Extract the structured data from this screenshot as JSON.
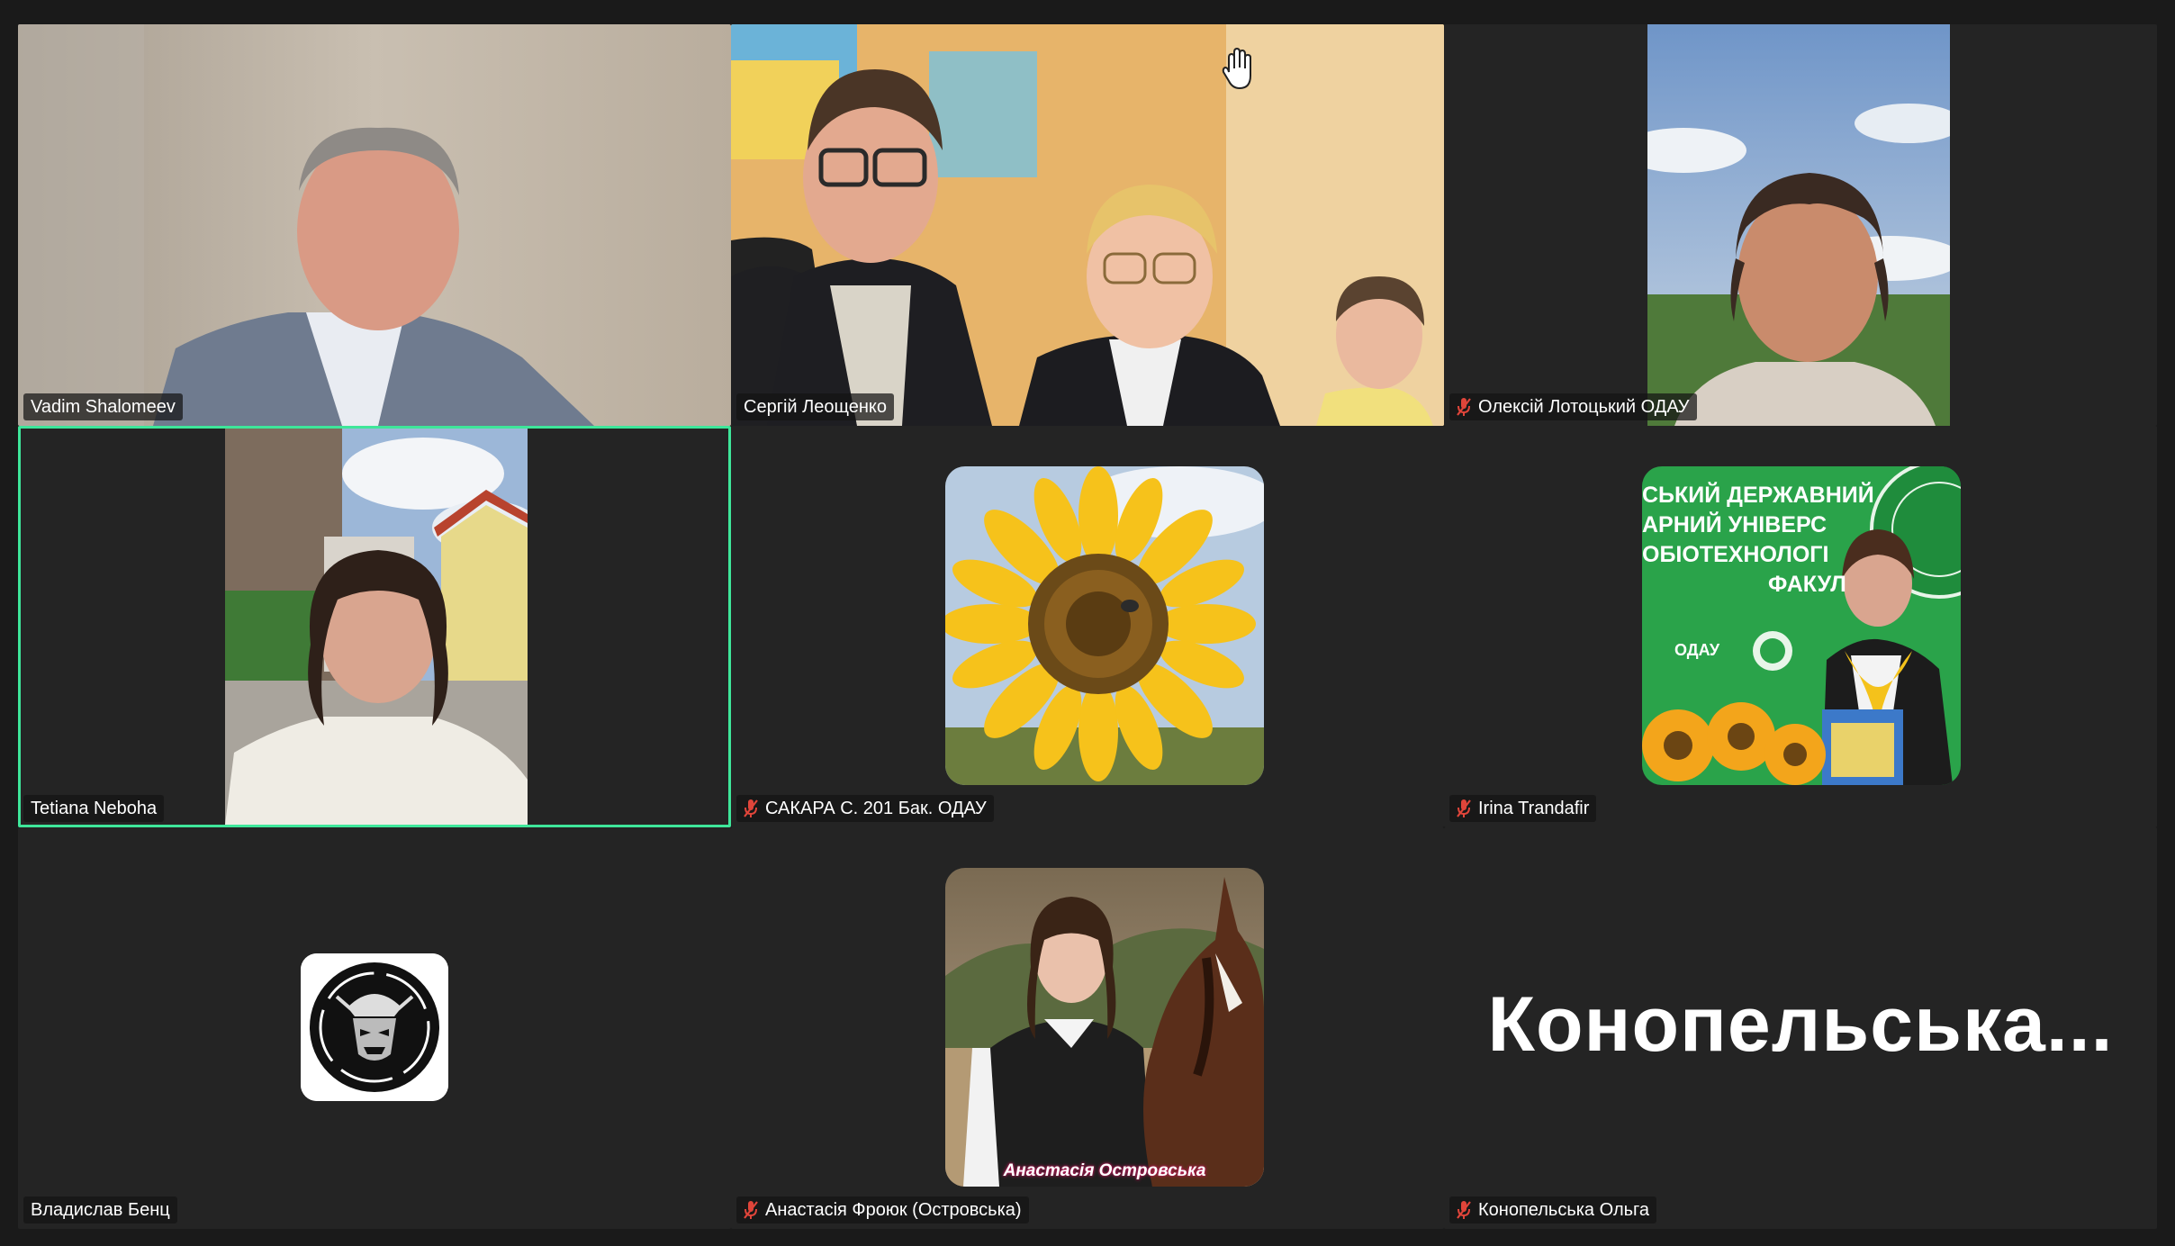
{
  "meeting": {
    "participants": [
      {
        "name": "Vadim Shalomeev",
        "muted": false,
        "active_speaker": false
      },
      {
        "name": "Сергій Леощенко",
        "muted": false,
        "active_speaker": false,
        "hand_raised": true
      },
      {
        "name": "Олексій Лотоцький ОДАУ",
        "muted": true,
        "active_speaker": false
      },
      {
        "name": "Tetiana Neboha",
        "muted": false,
        "active_speaker": true
      },
      {
        "name": "САКАРА С. 201  Бак. ОДАУ",
        "muted": true,
        "active_speaker": false
      },
      {
        "name": "Irina Trandafir",
        "muted": true,
        "active_speaker": false
      },
      {
        "name": "Владислав Бенц",
        "muted": false,
        "active_speaker": false
      },
      {
        "name": "Анастасія Фроюк (Островська)",
        "muted": true,
        "active_speaker": false
      },
      {
        "name": "Конопельська Ольга",
        "muted": true,
        "active_speaker": false
      }
    ],
    "placeholder_name": "Конопельська...",
    "banner_lines": [
      "СЬКИЙ ДЕРЖАВНИЙ",
      "АРНИЙ УНІВЕРС",
      "ОБІОТЕХНОЛОГІ",
      "ФАКУЛ"
    ],
    "banner_logo_text": "ОДАУ",
    "photo_caption": "Анастасія Островська",
    "colors": {
      "background": "#1a1a1a",
      "tile": "#242424",
      "active_border": "#3ee69a",
      "mic_muted": "#e0453a"
    }
  }
}
